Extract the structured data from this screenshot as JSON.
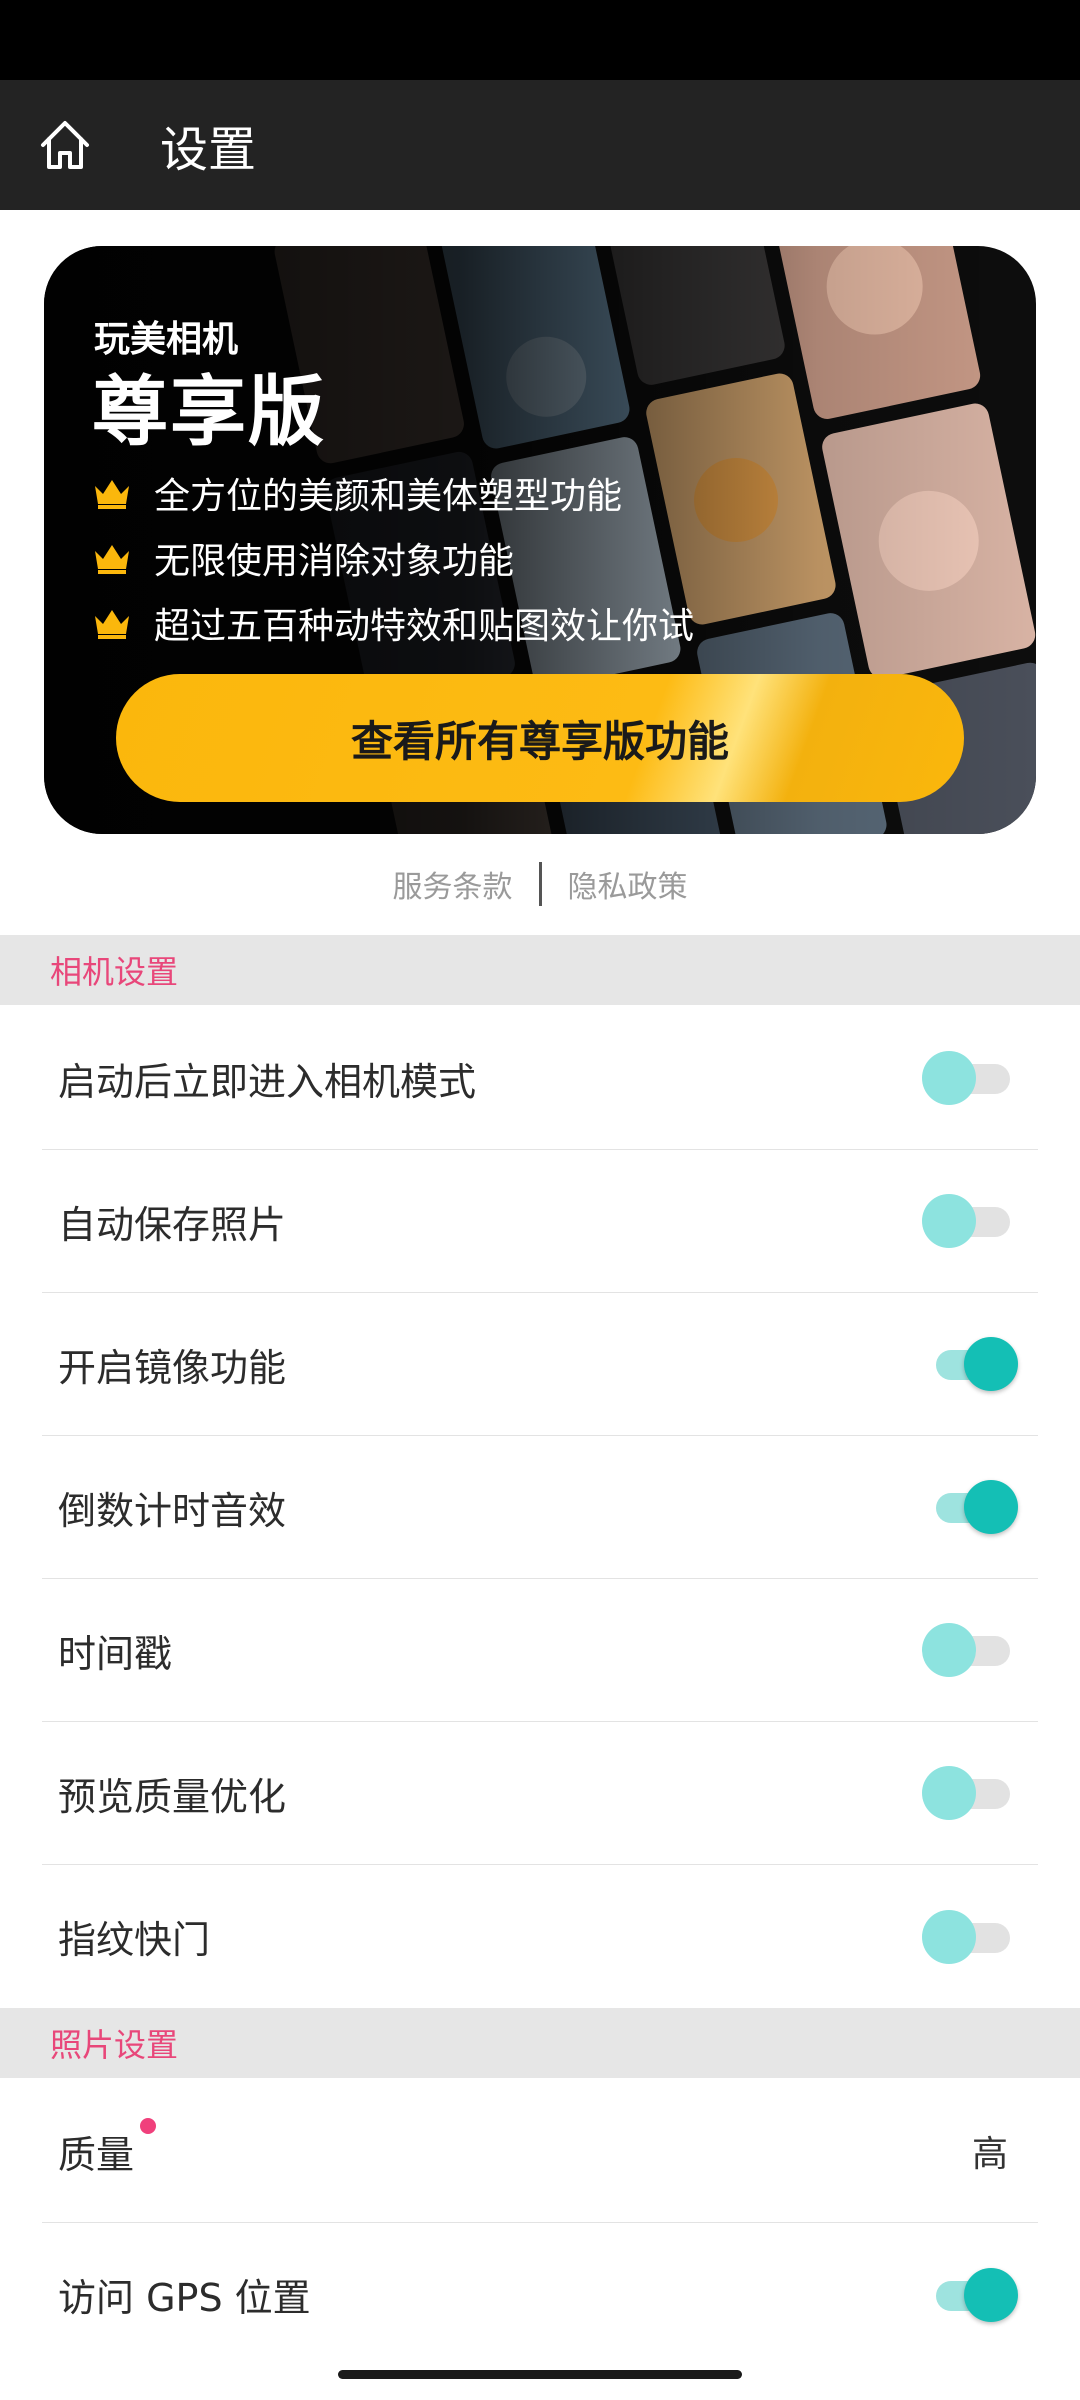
{
  "appbar": {
    "title": "设置"
  },
  "promo": {
    "app_name": "玩美相机",
    "edition": "尊享版",
    "features": [
      "全方位的美颜和美体塑型功能",
      "无限使用消除对象功能",
      "超过五百种动特效和贴图效让你试"
    ],
    "cta_label": "查看所有尊享版功能"
  },
  "legal": {
    "terms": "服务条款",
    "privacy": "隐私政策"
  },
  "camera_section": {
    "title": "相机设置",
    "items": [
      {
        "label": "启动后立即进入相机模式",
        "enabled": false
      },
      {
        "label": "自动保存照片",
        "enabled": false
      },
      {
        "label": "开启镜像功能",
        "enabled": true
      },
      {
        "label": "倒数计时音效",
        "enabled": true
      },
      {
        "label": "时间戳",
        "enabled": false
      },
      {
        "label": "预览质量优化",
        "enabled": false
      },
      {
        "label": "指纹快门",
        "enabled": false
      }
    ]
  },
  "photo_section": {
    "title": "照片设置",
    "quality": {
      "label": "质量",
      "value": "高"
    },
    "gps": {
      "label": "访问 GPS 位置",
      "enabled": true
    }
  },
  "colors": {
    "accent": "#14bfb5",
    "section_title": "#e8477a",
    "cta": "#fbb70c",
    "appbar": "#232323"
  },
  "icons": {
    "home": "home-icon",
    "crown": "crown-icon"
  }
}
